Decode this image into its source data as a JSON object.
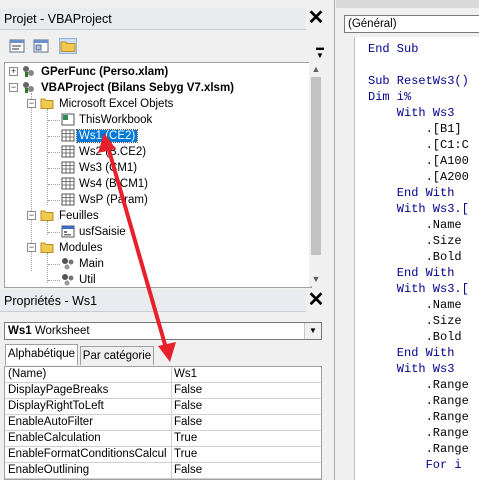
{
  "project": {
    "title": "Projet - VBAProject",
    "toolbar_icons": [
      "view-code-icon",
      "view-object-icon",
      "toggle-folders-icon"
    ],
    "tree": {
      "items": [
        {
          "label": "GPerFunc (Perso.xlam)",
          "icon": "vba-project-icon",
          "bold": true
        },
        {
          "label": "VBAProject (Bilans Sebyg V7.xlsm)",
          "icon": "vba-project-icon",
          "bold": true
        },
        {
          "label": "Microsoft Excel Objets",
          "icon": "folder-icon"
        },
        {
          "label": "ThisWorkbook",
          "icon": "workbook-icon"
        },
        {
          "label": "Ws1 (CE2)",
          "icon": "worksheet-icon",
          "selected": true
        },
        {
          "label": "Ws2 (B.CE2)",
          "icon": "worksheet-icon"
        },
        {
          "label": "Ws3 (CM1)",
          "icon": "worksheet-icon"
        },
        {
          "label": "Ws4 (B.CM1)",
          "icon": "worksheet-icon"
        },
        {
          "label": "WsP (Param)",
          "icon": "worksheet-icon"
        },
        {
          "label": "Feuilles",
          "icon": "folder-icon"
        },
        {
          "label": "usfSaisie",
          "icon": "userform-icon"
        },
        {
          "label": "Modules",
          "icon": "folder-icon"
        },
        {
          "label": "Main",
          "icon": "module-icon"
        },
        {
          "label": "Util",
          "icon": "module-icon"
        }
      ]
    }
  },
  "properties": {
    "title": "Propriétés - Ws1",
    "object_name": "Ws1",
    "object_type": "Worksheet",
    "tabs": [
      "Alphabétique",
      "Par catégorie"
    ],
    "rows": [
      {
        "name": "(Name)",
        "value": "Ws1"
      },
      {
        "name": "DisplayPageBreaks",
        "value": "False"
      },
      {
        "name": "DisplayRightToLeft",
        "value": "False"
      },
      {
        "name": "EnableAutoFilter",
        "value": "False"
      },
      {
        "name": "EnableCalculation",
        "value": "True"
      },
      {
        "name": "EnableFormatConditionsCalculatio",
        "value": "True"
      },
      {
        "name": "EnableOutlining",
        "value": "False"
      }
    ]
  },
  "code": {
    "object_combo": "(Général)",
    "lines": [
      {
        "text": "End Sub",
        "kw": true
      },
      {
        "text": "",
        "kw": false
      },
      {
        "text": "Sub ResetWs3()",
        "kw": true
      },
      {
        "text": "Dim i%",
        "kw": true
      },
      {
        "text": "    With Ws3",
        "kw": true
      },
      {
        "text": "        .[B1]",
        "kw": false
      },
      {
        "text": "        .[C1:C",
        "kw": false
      },
      {
        "text": "        .[A100",
        "kw": false
      },
      {
        "text": "        .[A200",
        "kw": false
      },
      {
        "text": "    End With",
        "kw": true
      },
      {
        "text": "    With Ws3.[",
        "kw": true
      },
      {
        "text": "        .Name",
        "kw": false
      },
      {
        "text": "        .Size",
        "kw": false
      },
      {
        "text": "        .Bold",
        "kw": false
      },
      {
        "text": "    End With",
        "kw": true
      },
      {
        "text": "    With Ws3.[",
        "kw": true
      },
      {
        "text": "        .Name",
        "kw": false
      },
      {
        "text": "        .Size",
        "kw": false
      },
      {
        "text": "        .Bold",
        "kw": false
      },
      {
        "text": "    End With",
        "kw": true
      },
      {
        "text": "    With Ws3",
        "kw": true
      },
      {
        "text": "        .Range",
        "kw": false
      },
      {
        "text": "        .Range",
        "kw": false
      },
      {
        "text": "        .Range",
        "kw": false
      },
      {
        "text": "        .Range",
        "kw": false
      },
      {
        "text": "        .Range",
        "kw": false
      },
      {
        "text": "        For i",
        "kw": true
      }
    ]
  },
  "colors": {
    "selection": "#0078d7",
    "keyword": "#00008b",
    "annotation_arrow": "#e8202a"
  }
}
